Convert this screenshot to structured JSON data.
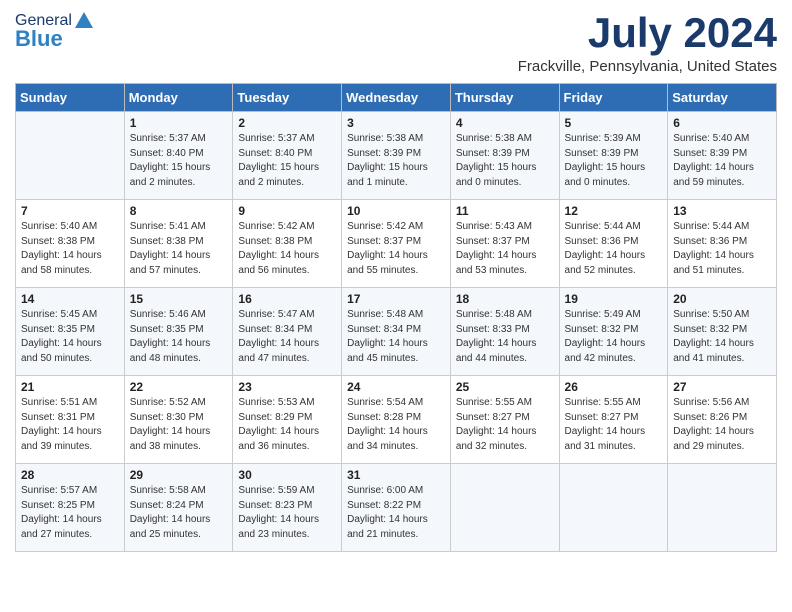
{
  "header": {
    "logo_general": "General",
    "logo_blue": "Blue",
    "month_title": "July 2024",
    "location": "Frackville, Pennsylvania, United States"
  },
  "weekdays": [
    "Sunday",
    "Monday",
    "Tuesday",
    "Wednesday",
    "Thursday",
    "Friday",
    "Saturday"
  ],
  "weeks": [
    [
      {
        "day": "",
        "content": ""
      },
      {
        "day": "1",
        "content": "Sunrise: 5:37 AM\nSunset: 8:40 PM\nDaylight: 15 hours\nand 2 minutes."
      },
      {
        "day": "2",
        "content": "Sunrise: 5:37 AM\nSunset: 8:40 PM\nDaylight: 15 hours\nand 2 minutes."
      },
      {
        "day": "3",
        "content": "Sunrise: 5:38 AM\nSunset: 8:39 PM\nDaylight: 15 hours\nand 1 minute."
      },
      {
        "day": "4",
        "content": "Sunrise: 5:38 AM\nSunset: 8:39 PM\nDaylight: 15 hours\nand 0 minutes."
      },
      {
        "day": "5",
        "content": "Sunrise: 5:39 AM\nSunset: 8:39 PM\nDaylight: 15 hours\nand 0 minutes."
      },
      {
        "day": "6",
        "content": "Sunrise: 5:40 AM\nSunset: 8:39 PM\nDaylight: 14 hours\nand 59 minutes."
      }
    ],
    [
      {
        "day": "7",
        "content": "Sunrise: 5:40 AM\nSunset: 8:38 PM\nDaylight: 14 hours\nand 58 minutes."
      },
      {
        "day": "8",
        "content": "Sunrise: 5:41 AM\nSunset: 8:38 PM\nDaylight: 14 hours\nand 57 minutes."
      },
      {
        "day": "9",
        "content": "Sunrise: 5:42 AM\nSunset: 8:38 PM\nDaylight: 14 hours\nand 56 minutes."
      },
      {
        "day": "10",
        "content": "Sunrise: 5:42 AM\nSunset: 8:37 PM\nDaylight: 14 hours\nand 55 minutes."
      },
      {
        "day": "11",
        "content": "Sunrise: 5:43 AM\nSunset: 8:37 PM\nDaylight: 14 hours\nand 53 minutes."
      },
      {
        "day": "12",
        "content": "Sunrise: 5:44 AM\nSunset: 8:36 PM\nDaylight: 14 hours\nand 52 minutes."
      },
      {
        "day": "13",
        "content": "Sunrise: 5:44 AM\nSunset: 8:36 PM\nDaylight: 14 hours\nand 51 minutes."
      }
    ],
    [
      {
        "day": "14",
        "content": "Sunrise: 5:45 AM\nSunset: 8:35 PM\nDaylight: 14 hours\nand 50 minutes."
      },
      {
        "day": "15",
        "content": "Sunrise: 5:46 AM\nSunset: 8:35 PM\nDaylight: 14 hours\nand 48 minutes."
      },
      {
        "day": "16",
        "content": "Sunrise: 5:47 AM\nSunset: 8:34 PM\nDaylight: 14 hours\nand 47 minutes."
      },
      {
        "day": "17",
        "content": "Sunrise: 5:48 AM\nSunset: 8:34 PM\nDaylight: 14 hours\nand 45 minutes."
      },
      {
        "day": "18",
        "content": "Sunrise: 5:48 AM\nSunset: 8:33 PM\nDaylight: 14 hours\nand 44 minutes."
      },
      {
        "day": "19",
        "content": "Sunrise: 5:49 AM\nSunset: 8:32 PM\nDaylight: 14 hours\nand 42 minutes."
      },
      {
        "day": "20",
        "content": "Sunrise: 5:50 AM\nSunset: 8:32 PM\nDaylight: 14 hours\nand 41 minutes."
      }
    ],
    [
      {
        "day": "21",
        "content": "Sunrise: 5:51 AM\nSunset: 8:31 PM\nDaylight: 14 hours\nand 39 minutes."
      },
      {
        "day": "22",
        "content": "Sunrise: 5:52 AM\nSunset: 8:30 PM\nDaylight: 14 hours\nand 38 minutes."
      },
      {
        "day": "23",
        "content": "Sunrise: 5:53 AM\nSunset: 8:29 PM\nDaylight: 14 hours\nand 36 minutes."
      },
      {
        "day": "24",
        "content": "Sunrise: 5:54 AM\nSunset: 8:28 PM\nDaylight: 14 hours\nand 34 minutes."
      },
      {
        "day": "25",
        "content": "Sunrise: 5:55 AM\nSunset: 8:27 PM\nDaylight: 14 hours\nand 32 minutes."
      },
      {
        "day": "26",
        "content": "Sunrise: 5:55 AM\nSunset: 8:27 PM\nDaylight: 14 hours\nand 31 minutes."
      },
      {
        "day": "27",
        "content": "Sunrise: 5:56 AM\nSunset: 8:26 PM\nDaylight: 14 hours\nand 29 minutes."
      }
    ],
    [
      {
        "day": "28",
        "content": "Sunrise: 5:57 AM\nSunset: 8:25 PM\nDaylight: 14 hours\nand 27 minutes."
      },
      {
        "day": "29",
        "content": "Sunrise: 5:58 AM\nSunset: 8:24 PM\nDaylight: 14 hours\nand 25 minutes."
      },
      {
        "day": "30",
        "content": "Sunrise: 5:59 AM\nSunset: 8:23 PM\nDaylight: 14 hours\nand 23 minutes."
      },
      {
        "day": "31",
        "content": "Sunrise: 6:00 AM\nSunset: 8:22 PM\nDaylight: 14 hours\nand 21 minutes."
      },
      {
        "day": "",
        "content": ""
      },
      {
        "day": "",
        "content": ""
      },
      {
        "day": "",
        "content": ""
      }
    ]
  ]
}
